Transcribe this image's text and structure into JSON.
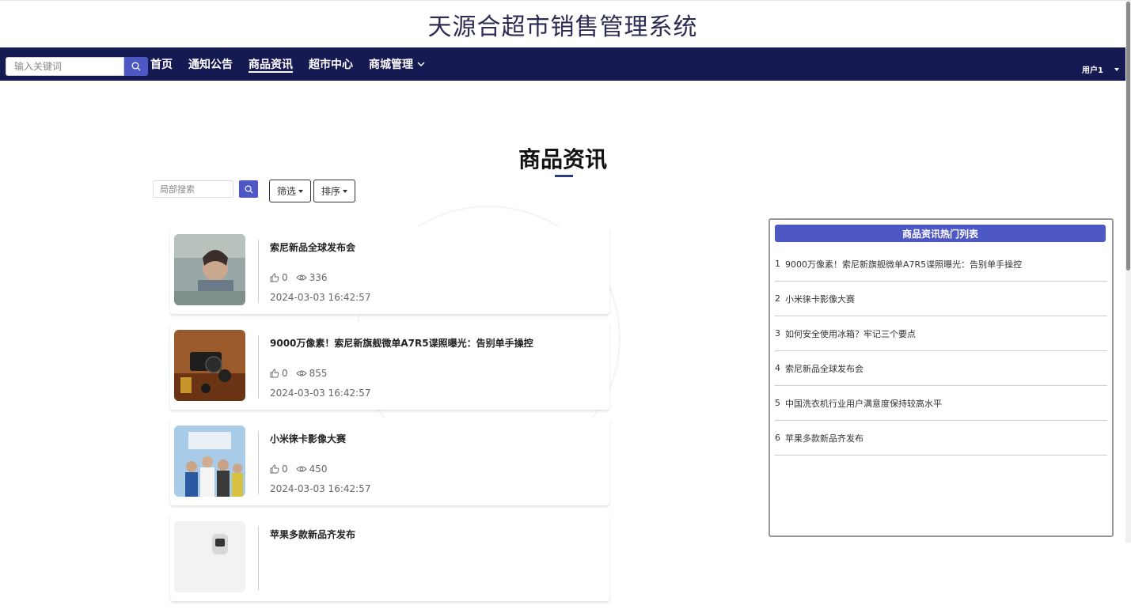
{
  "site": {
    "title": "天源合超市销售管理系统"
  },
  "navbar": {
    "search_placeholder": "输入关键词",
    "items": [
      {
        "label": "首页",
        "active": false
      },
      {
        "label": "通知公告",
        "active": false
      },
      {
        "label": "商品资讯",
        "active": true
      },
      {
        "label": "超市中心",
        "active": false
      },
      {
        "label": "商城管理",
        "active": false,
        "has_dropdown": true
      }
    ],
    "user_label": "用户1"
  },
  "main": {
    "heading": "商品资讯",
    "local_search_placeholder": "局部搜索",
    "filter_label": "筛选",
    "sort_label": "排序"
  },
  "news": [
    {
      "title": "索尼新品全球发布会",
      "likes": "0",
      "views": "336",
      "date": "2024-03-03 16:42:57",
      "thumb_color": "#8a9a9c"
    },
    {
      "title": "9000万像素！索尼新旗舰微单A7R5谍照曝光：告别单手操控",
      "likes": "0",
      "views": "855",
      "date": "2024-03-03 16:42:57",
      "thumb_color": "#8b4a1e"
    },
    {
      "title": "小米徕卡影像大赛",
      "likes": "0",
      "views": "450",
      "date": "2024-03-03 16:42:57",
      "thumb_color": "#9fc4e4"
    },
    {
      "title": "苹果多款新品齐发布",
      "likes": "",
      "views": "",
      "date": "",
      "thumb_color": "#e8e8e8"
    }
  ],
  "hot_list": {
    "title": "商品资讯热门列表",
    "items": [
      {
        "num": "1",
        "text": "9000万像素！索尼新旗舰微单A7R5谍照曝光：告别单手操控"
      },
      {
        "num": "2",
        "text": "小米徕卡影像大赛"
      },
      {
        "num": "3",
        "text": "如何安全使用冰箱？牢记三个要点"
      },
      {
        "num": "4",
        "text": "索尼新品全球发布会"
      },
      {
        "num": "5",
        "text": "中国洗衣机行业用户满意度保持较高水平"
      },
      {
        "num": "6",
        "text": "苹果多款新品齐发布"
      }
    ]
  },
  "colors": {
    "navbar": "#161a52",
    "accent": "#4e58c4",
    "title": "#2c2c54"
  }
}
